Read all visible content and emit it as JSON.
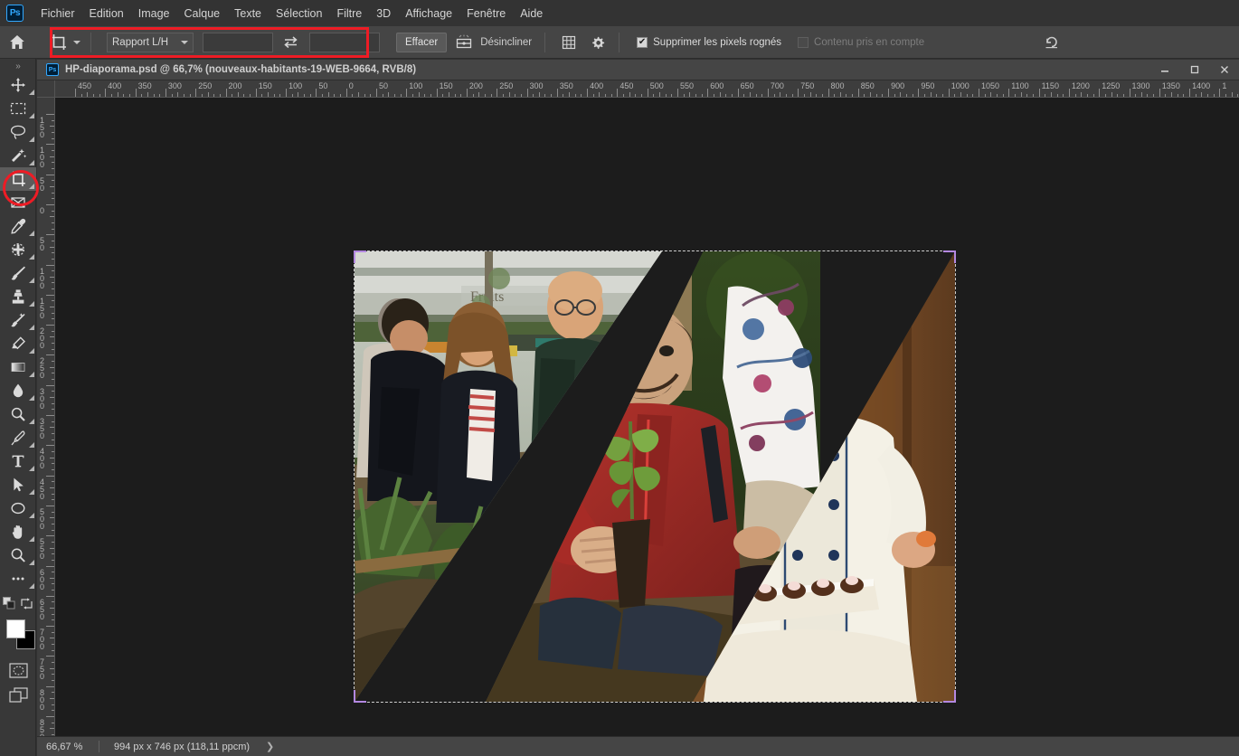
{
  "app": {
    "name": "Adobe Photoshop",
    "logo_text": "Ps",
    "accent_color": "#31a8ff",
    "annotation_color": "#ee1c25"
  },
  "menubar": {
    "items": [
      {
        "label": "Fichier"
      },
      {
        "label": "Edition"
      },
      {
        "label": "Image"
      },
      {
        "label": "Calque"
      },
      {
        "label": "Texte"
      },
      {
        "label": "Sélection"
      },
      {
        "label": "Filtre"
      },
      {
        "label": "3D"
      },
      {
        "label": "Affichage"
      },
      {
        "label": "Fenêtre"
      },
      {
        "label": "Aide"
      }
    ]
  },
  "options_bar": {
    "home_icon": "home-icon",
    "tool_preset_icon": "crop-tool-icon",
    "ratio_select": {
      "value": "Rapport L/H",
      "chevron": "chevron-down-icon"
    },
    "width_field": {
      "value": "",
      "placeholder": ""
    },
    "swap_icon": "swap-arrows-icon",
    "height_field": {
      "value": "",
      "placeholder": ""
    },
    "clear_button": "Effacer",
    "straighten_icon": "straighten-icon",
    "straighten_label": "Désincliner",
    "overlay_icon": "grid-overlay-icon",
    "settings_icon": "gear-icon",
    "delete_cropped": {
      "label": "Supprimer les pixels rognés",
      "checked": true,
      "check_glyph": "✔"
    },
    "content_aware": {
      "label": "Contenu pris en compte",
      "checked": false,
      "disabled": true
    },
    "reset_icon": "reset-arrow-icon"
  },
  "toolbar": {
    "collapse_icon": "double-chevron-right-icon",
    "tools": [
      {
        "name": "move-tool",
        "icon": "move-icon",
        "selected": false,
        "has_flyout": true
      },
      {
        "name": "marquee-tool",
        "icon": "rectangular-marquee-icon",
        "selected": false,
        "has_flyout": true
      },
      {
        "name": "lasso-tool",
        "icon": "lasso-icon",
        "selected": false,
        "has_flyout": true
      },
      {
        "name": "magic-wand-tool",
        "icon": "magic-wand-icon",
        "selected": false,
        "has_flyout": true
      },
      {
        "name": "crop-tool",
        "icon": "crop-icon",
        "selected": true,
        "has_flyout": true
      },
      {
        "name": "frame-tool",
        "icon": "frame-icon",
        "selected": false,
        "has_flyout": false
      },
      {
        "name": "eyedropper-tool",
        "icon": "eyedropper-icon",
        "selected": false,
        "has_flyout": true
      },
      {
        "name": "healing-brush-tool",
        "icon": "spot-healing-icon",
        "selected": false,
        "has_flyout": true
      },
      {
        "name": "brush-tool",
        "icon": "paintbrush-icon",
        "selected": false,
        "has_flyout": true
      },
      {
        "name": "clone-stamp-tool",
        "icon": "clone-stamp-icon",
        "selected": false,
        "has_flyout": true
      },
      {
        "name": "history-brush-tool",
        "icon": "history-brush-icon",
        "selected": false,
        "has_flyout": true
      },
      {
        "name": "eraser-tool",
        "icon": "eraser-icon",
        "selected": false,
        "has_flyout": true
      },
      {
        "name": "gradient-tool",
        "icon": "gradient-icon",
        "selected": false,
        "has_flyout": true
      },
      {
        "name": "blur-tool",
        "icon": "blur-droplet-icon",
        "selected": false,
        "has_flyout": true
      },
      {
        "name": "dodge-tool",
        "icon": "dodge-icon",
        "selected": false,
        "has_flyout": true
      },
      {
        "name": "pen-tool",
        "icon": "pen-icon",
        "selected": false,
        "has_flyout": true
      },
      {
        "name": "type-tool",
        "icon": "type-T-icon",
        "selected": false,
        "has_flyout": true
      },
      {
        "name": "path-selection-tool",
        "icon": "path-arrow-icon",
        "selected": false,
        "has_flyout": true
      },
      {
        "name": "shape-tool",
        "icon": "ellipse-icon",
        "selected": false,
        "has_flyout": true
      },
      {
        "name": "hand-tool",
        "icon": "hand-icon",
        "selected": false,
        "has_flyout": true
      },
      {
        "name": "zoom-tool",
        "icon": "magnifier-icon",
        "selected": false,
        "has_flyout": false
      },
      {
        "name": "edit-toolbar",
        "icon": "ellipsis-icon",
        "selected": false,
        "has_flyout": false
      }
    ],
    "default_colors_icon": "default-colors-icon",
    "swap_colors_icon": "swap-colors-icon",
    "foreground_color": "#ffffff",
    "background_color": "#000000",
    "quick_mask_icon": "quick-mask-icon",
    "screen_mode_icon": "screen-mode-icon"
  },
  "document": {
    "title": "HP-diaporama.psd @ 66,7% (nouveaux-habitants-19-WEB-9664, RVB/8)",
    "icon": "ps-document-icon",
    "window_controls": {
      "minimize": "minimize-icon",
      "maximize": "maximize-icon",
      "close": "close-icon"
    }
  },
  "rulers": {
    "horizontal_labels": [
      "450",
      "400",
      "350",
      "300",
      "250",
      "200",
      "150",
      "100",
      "50",
      "0",
      "50",
      "100",
      "150",
      "200",
      "250",
      "300",
      "350",
      "400",
      "450",
      "500",
      "550",
      "600",
      "650",
      "700",
      "750",
      "800",
      "850",
      "900",
      "950",
      "1000",
      "1050",
      "1100",
      "1150",
      "1200",
      "1250",
      "1300",
      "1350",
      "1400",
      "1"
    ],
    "vertical_labels": [
      "150",
      "100",
      "50",
      "0",
      "50",
      "100",
      "150",
      "200",
      "250",
      "300",
      "350",
      "400",
      "450",
      "500",
      "550",
      "600",
      "650",
      "700",
      "750",
      "800",
      "850"
    ],
    "unit": "px"
  },
  "canvas": {
    "image_alt": "Collage de trois photographies séparées par des bandes diagonales blanches",
    "panels": [
      {
        "name": "panel-jardinage",
        "description": "Trois personnes jardinant en ville"
      },
      {
        "name": "panel-plantation",
        "description": "Homme en veste rouge tenant une jeune pousse"
      },
      {
        "name": "panel-chef",
        "description": "Chef pâtissier présentant un plateau de desserts"
      }
    ],
    "crop_handles": [
      "top-left",
      "top-right",
      "bottom-left",
      "bottom-right"
    ]
  },
  "statusbar": {
    "zoom": "66,67 %",
    "doc_info": "994 px x 746 px (118,11 ppcm)",
    "expand_icon": "chevron-right-icon"
  }
}
